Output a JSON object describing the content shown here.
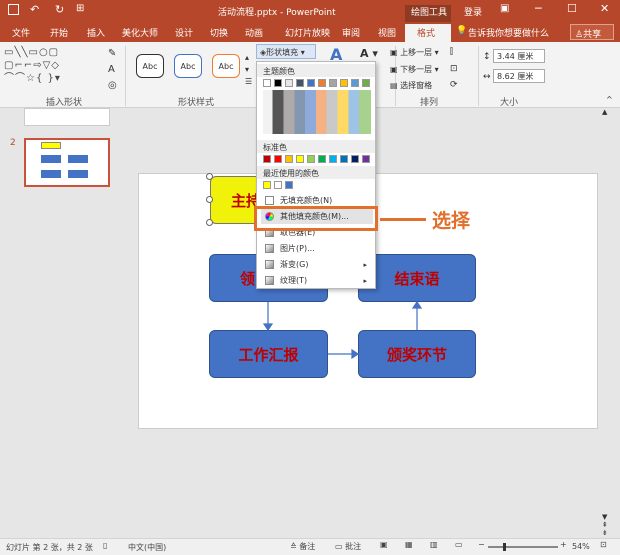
{
  "titlebar": {
    "title": "活动流程.pptx - PowerPoint",
    "context_tab": "绘图工具",
    "login": "登录"
  },
  "tabs": [
    "文件",
    "开始",
    "插入",
    "美化大师",
    "设计",
    "切换",
    "动画",
    "幻灯片放映",
    "审阅",
    "视图",
    "格式"
  ],
  "tellme": "告诉我你想要做什么",
  "share": "共享",
  "ribbon": {
    "group_insert_shapes": "插入形状",
    "group_shape_styles": "形状样式",
    "group_arrange": "排列",
    "group_size": "大小",
    "style_samples": [
      "Abc",
      "Abc",
      "Abc"
    ],
    "fill_button": "形状填充",
    "arrange": {
      "bring_forward": "上移一层",
      "send_backward": "下移一层",
      "selection_pane": "选择窗格"
    },
    "size": {
      "height": "3.44 厘米",
      "width": "8.62 厘米"
    }
  },
  "menu": {
    "theme_colors_label": "主题颜色",
    "standard_colors_label": "标准色",
    "recent_colors_label": "最近使用的颜色",
    "items": [
      {
        "label": "无填充颜色(N)",
        "icon": "no-fill-icon"
      },
      {
        "label": "其他填充颜色(M)...",
        "icon": "color-wheel-icon"
      },
      {
        "label": "取色器(E)",
        "icon": "eyedropper-icon"
      },
      {
        "label": "图片(P)...",
        "icon": "picture-icon"
      },
      {
        "label": "渐变(G)",
        "icon": "gradient-icon"
      },
      {
        "label": "纹理(T)",
        "icon": "texture-icon"
      }
    ],
    "theme_top": [
      "#ffffff",
      "#000000",
      "#e7e6e6",
      "#44546a",
      "#4472c4",
      "#ed7d31",
      "#a5a5a5",
      "#ffc000",
      "#5b9bd5",
      "#70ad47"
    ],
    "standard": [
      "#c00000",
      "#ff0000",
      "#ffc000",
      "#ffff00",
      "#92d050",
      "#00b050",
      "#00b0f0",
      "#0070c0",
      "#002060",
      "#7030a0"
    ],
    "recent": [
      "#ffff00",
      "#ffffff",
      "#4472c4"
    ]
  },
  "annotation": "选择",
  "slides": {
    "current_index": "2"
  },
  "diagram": {
    "host": "主持",
    "lead": "领",
    "closing": "结束语",
    "report": "工作汇报",
    "awards": "颁奖环节"
  },
  "status": {
    "slide_info": "幻灯片 第 2 张，共 2 张",
    "language": "中文(中国)",
    "notes": "备注",
    "comments": "批注",
    "zoom": "54%"
  }
}
